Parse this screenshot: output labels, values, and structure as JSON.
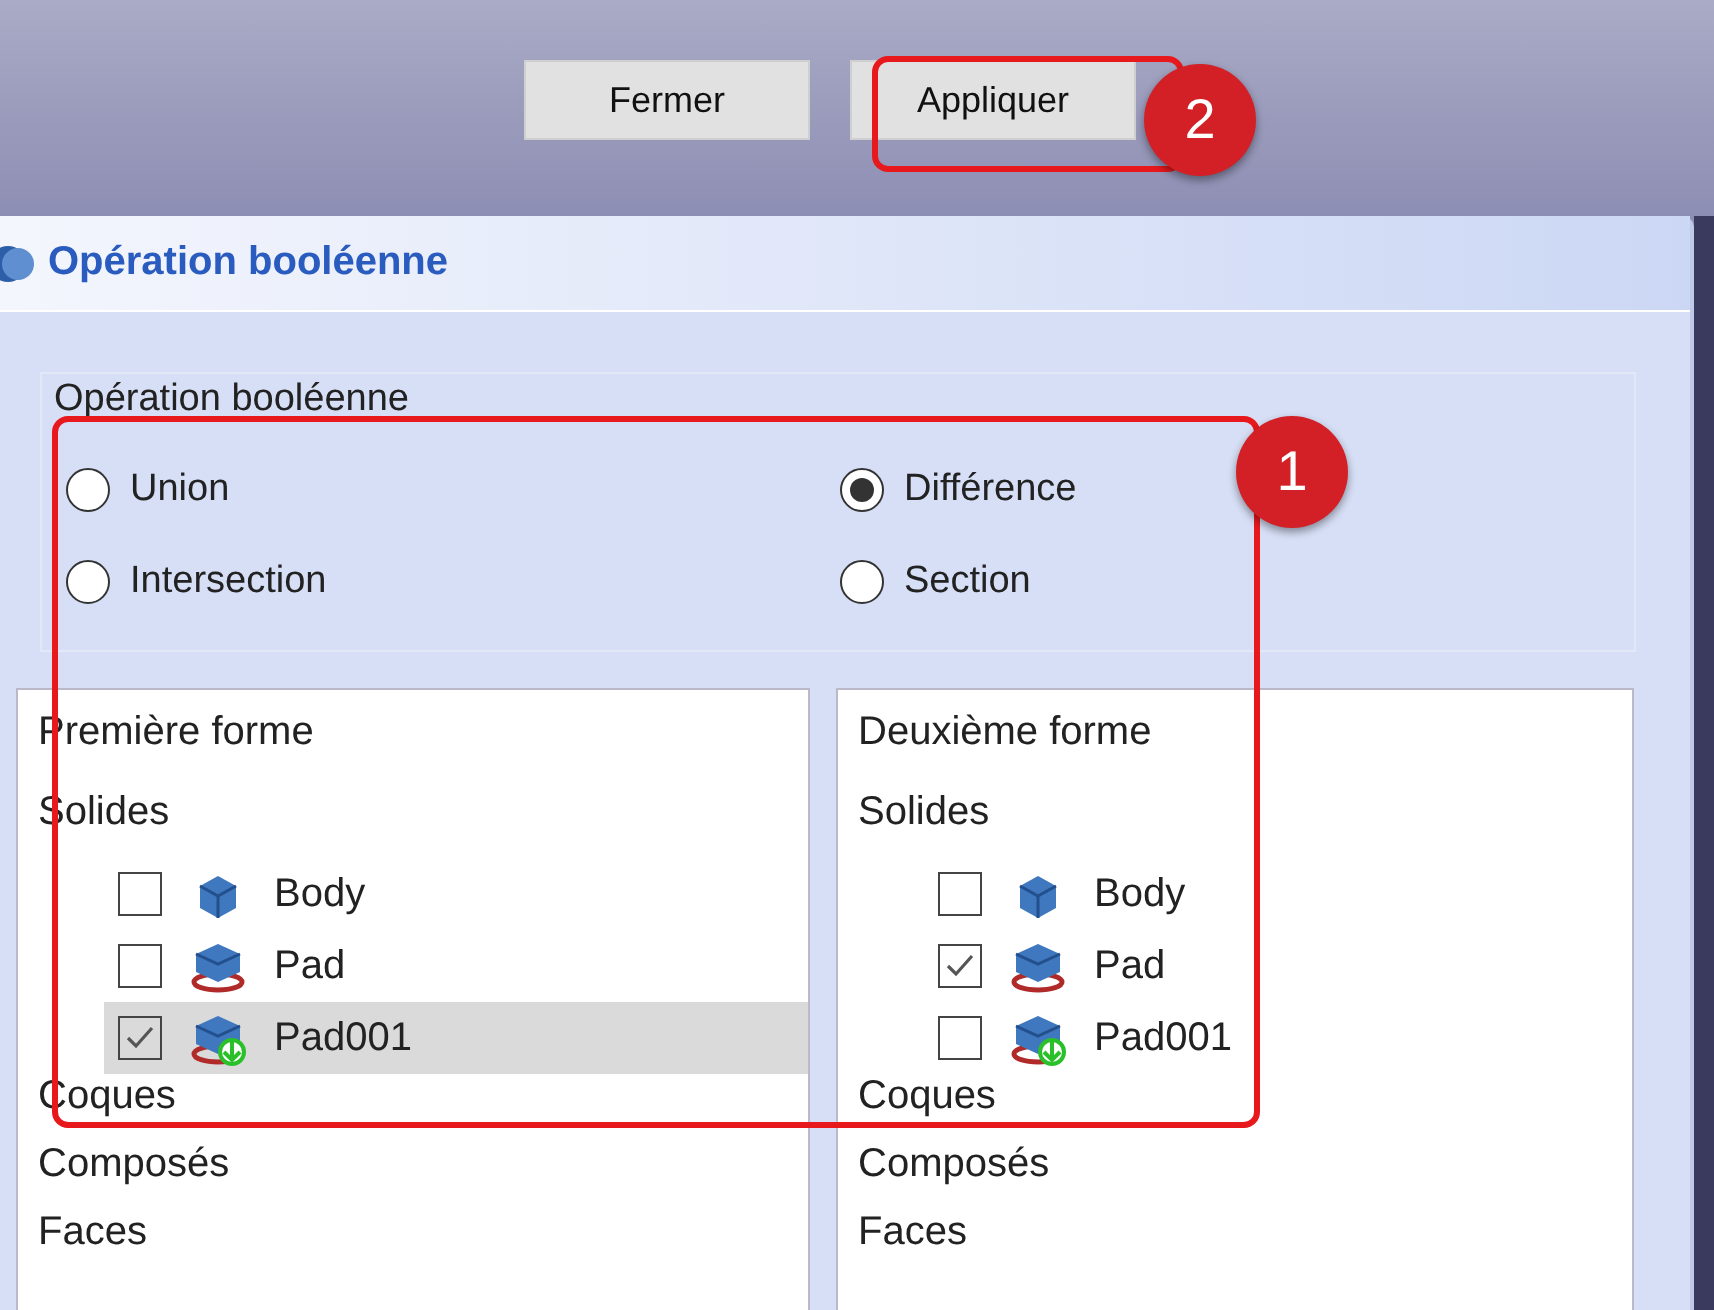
{
  "buttons": [
    {
      "label": "Fermer"
    },
    {
      "label": "Appliquer"
    }
  ],
  "panel": {
    "title": "Opération booléenne",
    "group": {
      "label": "Opération booléenne",
      "options": [
        {
          "label": "Union",
          "selected": false
        },
        {
          "label": "Différence",
          "selected": true
        },
        {
          "label": "Intersection",
          "selected": false
        },
        {
          "label": "Section",
          "selected": false
        }
      ]
    },
    "lists": [
      {
        "title": "Première forme",
        "categories": [
          {
            "label": "Solides",
            "children": [
              {
                "label": "Body",
                "kind": "body",
                "checked": false,
                "selected": false
              },
              {
                "label": "Pad",
                "kind": "pad",
                "checked": false,
                "selected": false
              },
              {
                "label": "Pad001",
                "kind": "pad_new",
                "checked": true,
                "selected": true
              }
            ]
          },
          {
            "label": "Coques"
          },
          {
            "label": "Composés"
          },
          {
            "label": "Faces"
          }
        ]
      },
      {
        "title": "Deuxième forme",
        "categories": [
          {
            "label": "Solides",
            "children": [
              {
                "label": "Body",
                "kind": "body",
                "checked": false,
                "selected": false
              },
              {
                "label": "Pad",
                "kind": "pad",
                "checked": true,
                "selected": false
              },
              {
                "label": "Pad001",
                "kind": "pad_new",
                "checked": false,
                "selected": false
              }
            ]
          },
          {
            "label": "Coques"
          },
          {
            "label": "Composés"
          },
          {
            "label": "Faces"
          }
        ]
      }
    ]
  },
  "annotations": [
    {
      "number": "1"
    },
    {
      "number": "2"
    }
  ]
}
